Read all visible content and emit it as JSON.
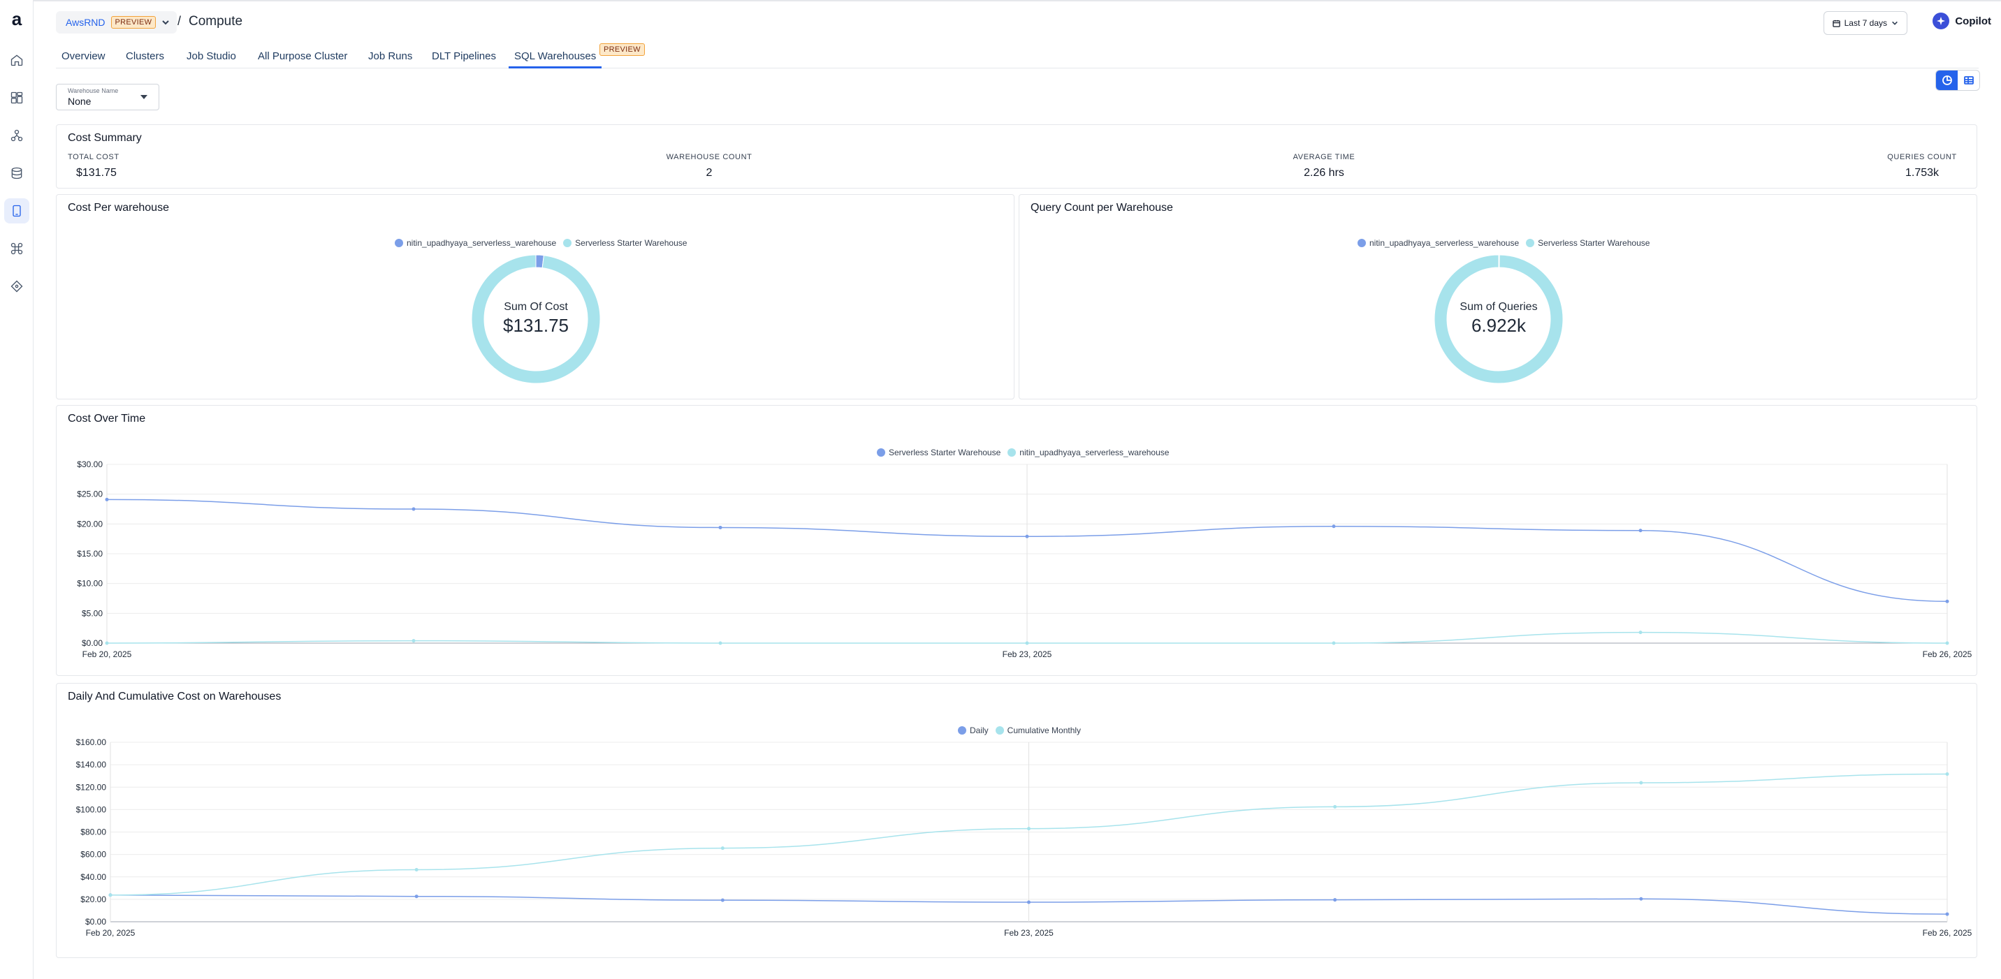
{
  "header": {
    "workspace": "AwsRND",
    "workspace_badge": "PREVIEW",
    "separator": "/",
    "title": "Compute",
    "date_range": "Last 7 days",
    "copilot": "Copilot"
  },
  "sidebar": {
    "logo": "a",
    "icons": [
      "home-icon",
      "dashboard-icon",
      "hierarchy-icon",
      "database-icon",
      "compute-icon",
      "integrations-icon",
      "tag-icon"
    ]
  },
  "tabs": [
    {
      "label": "Overview"
    },
    {
      "label": "Clusters"
    },
    {
      "label": "Job Studio"
    },
    {
      "label": "All Purpose Cluster"
    },
    {
      "label": "Job Runs"
    },
    {
      "label": "DLT Pipelines"
    },
    {
      "label": "SQL Warehouses",
      "active": true,
      "badge": "PREVIEW"
    }
  ],
  "filter": {
    "label": "Warehouse Name",
    "value": "None"
  },
  "summary": {
    "title": "Cost Summary",
    "items": [
      {
        "label": "TOTAL COST",
        "value": "$131.75"
      },
      {
        "label": "WAREHOUSE COUNT",
        "value": "2"
      },
      {
        "label": "AVERAGE TIME",
        "value": "2.26 hrs"
      },
      {
        "label": "QUERIES COUNT",
        "value": "1.753k"
      }
    ]
  },
  "colors": {
    "series_dark": "#7b9ee8",
    "series_light": "#a7e3ec",
    "accent": "#2563eb"
  },
  "chart_data": [
    {
      "type": "pie",
      "title": "Cost Per warehouse",
      "center_label": "Sum Of Cost",
      "center_value": "$131.75",
      "categories": [
        "nitin_upadhyaya_serverless_warehouse",
        "Serverless Starter Warehouse"
      ],
      "values": [
        2.6,
        129.15
      ]
    },
    {
      "type": "pie",
      "title": "Query Count per Warehouse",
      "center_label": "Sum of Queries",
      "center_value": "6.922k",
      "categories": [
        "nitin_upadhyaya_serverless_warehouse",
        "Serverless Starter Warehouse"
      ],
      "values": [
        14,
        6908
      ]
    },
    {
      "type": "line",
      "title": "Cost Over Time",
      "x": [
        "Feb 20, 2025",
        "Feb 21, 2025",
        "Feb 22, 2025",
        "Feb 23, 2025",
        "Feb 24, 2025",
        "Feb 25, 2025",
        "Feb 26, 2025"
      ],
      "x_tick_labels": [
        "Feb 20, 2025",
        "Feb 23, 2025",
        "Feb 26, 2025"
      ],
      "y_tick_labels": [
        "$0.00",
        "$5.00",
        "$10.00",
        "$15.00",
        "$20.00",
        "$25.00",
        "$30.00"
      ],
      "ylim": [
        0,
        30
      ],
      "grid": true,
      "legend": "top-center",
      "series": [
        {
          "name": "Serverless Starter Warehouse",
          "values": [
            24.1,
            22.5,
            19.4,
            17.9,
            19.6,
            18.9,
            7.0
          ]
        },
        {
          "name": "nitin_upadhyaya_serverless_warehouse",
          "values": [
            0.0,
            0.4,
            0.0,
            0.0,
            0.0,
            1.8,
            0.0
          ]
        }
      ]
    },
    {
      "type": "line",
      "title": "Daily And Cumulative Cost on Warehouses",
      "x": [
        "Feb 20, 2025",
        "Feb 21, 2025",
        "Feb 22, 2025",
        "Feb 23, 2025",
        "Feb 24, 2025",
        "Feb 25, 2025",
        "Feb 26, 2025"
      ],
      "x_tick_labels": [
        "Feb 20, 2025",
        "Feb 23, 2025",
        "Feb 26, 2025"
      ],
      "y_tick_labels": [
        "$0.00",
        "$20.00",
        "$40.00",
        "$60.00",
        "$80.00",
        "$100.00",
        "$120.00",
        "$140.00",
        "$160.00"
      ],
      "ylim": [
        0,
        160
      ],
      "grid": true,
      "legend": "top-center",
      "series": [
        {
          "name": "Daily",
          "values": [
            23.8,
            22.6,
            19.2,
            17.4,
            19.5,
            20.4,
            6.8
          ]
        },
        {
          "name": "Cumulative Monthly",
          "values": [
            23.8,
            46.4,
            65.6,
            83.0,
            102.5,
            123.9,
            131.7
          ]
        }
      ]
    }
  ]
}
